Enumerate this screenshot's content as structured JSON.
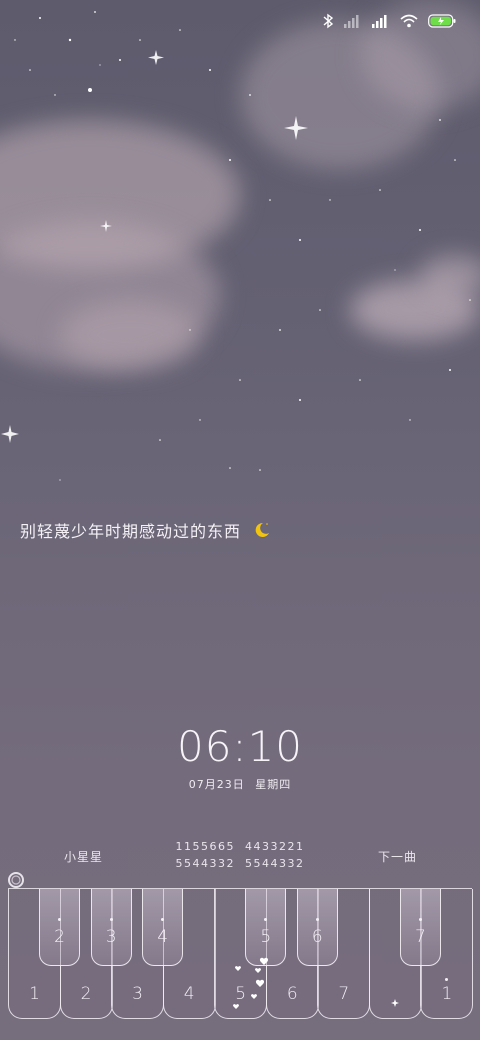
{
  "status_bar": {
    "icons": [
      "bluetooth-icon",
      "signal-weak-icon",
      "signal-full-icon",
      "wifi-icon",
      "battery-charging-icon"
    ],
    "colors": {
      "battery_fill": "#6fdc4a",
      "icon": "#ffffff"
    }
  },
  "quote": {
    "text": "别轻蔑少年时期感动过的东西",
    "emoji": "crescent-moon-icon"
  },
  "clock": {
    "time": "06:10",
    "date": "07月23日",
    "weekday": "星期四"
  },
  "music": {
    "song_title": "小星星",
    "score_line1_a": "1155665",
    "score_line1_b": "4433221",
    "score_line2_a": "5544332",
    "score_line2_b": "5544332",
    "next_label": "下一曲"
  },
  "piano": {
    "white_keys": [
      {
        "label": "1",
        "high": false
      },
      {
        "label": "2",
        "high": false
      },
      {
        "label": "3",
        "high": false
      },
      {
        "label": "4",
        "high": false
      },
      {
        "label": "5",
        "high": false
      },
      {
        "label": "6",
        "high": false
      },
      {
        "label": "7",
        "high": false
      },
      {
        "label": "",
        "high": false
      },
      {
        "label": "1",
        "high": true
      }
    ],
    "black_keys": [
      {
        "label": "2",
        "after": 1
      },
      {
        "label": "3",
        "after": 2
      },
      {
        "label": "4",
        "after": 3
      },
      {
        "label": "5",
        "after": 5
      },
      {
        "label": "6",
        "after": 6
      },
      {
        "label": "7",
        "after": 8
      }
    ]
  },
  "colors": {
    "sky_top": "#5d5b6c",
    "sky_bottom": "#766d7d",
    "moon": "#f1c40f"
  }
}
